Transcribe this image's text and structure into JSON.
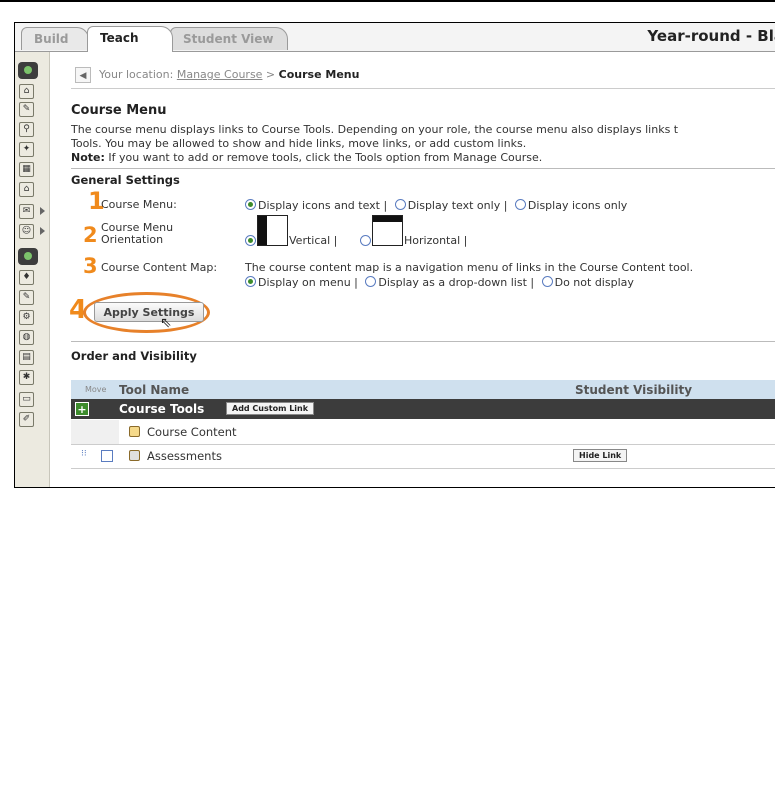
{
  "tabs": {
    "build": "Build",
    "teach": "Teach",
    "student_view": "Student View"
  },
  "course_title": "Year-round - Bla",
  "breadcrumb": {
    "prefix": "Your location:",
    "link": "Manage Course",
    "separator": " > ",
    "current": "Course Menu"
  },
  "page_title": "Course Menu",
  "description": {
    "line1": "The course menu displays links to Course Tools. Depending on your role, the course menu also displays links t",
    "line2": "Tools. You may be allowed to show and hide links, move links, or add custom links.",
    "note_label": "Note:",
    "note_text": " If you want to add or remove tools, click the Tools option from Manage Course."
  },
  "general_settings": {
    "heading": "General Settings",
    "steps": [
      "1",
      "2",
      "3",
      "4"
    ],
    "course_menu_label": "Course Menu:",
    "course_menu_options": [
      "Display icons and text |",
      "Display text only |",
      "Display icons only"
    ],
    "orientation_label_1": "Course Menu",
    "orientation_label_2": "Orientation",
    "orientation_options": [
      "Vertical |",
      "Horizontal |"
    ],
    "content_map_label": "Course Content Map:",
    "content_map_desc": "The course content map is a navigation menu of links in the Course Content tool.",
    "content_map_options": [
      "Display on menu |",
      "Display as a drop-down list |",
      "Do not display"
    ],
    "apply_button": "Apply Settings"
  },
  "order_visibility": {
    "heading": "Order and Visibility",
    "columns": {
      "move": "Move",
      "tool_name": "Tool Name",
      "student_visibility": "Student Visibility"
    },
    "group": {
      "name": "Course Tools",
      "add_button": "Add Custom Link"
    },
    "rows": [
      {
        "name": "Course Content"
      },
      {
        "name": "Assessments",
        "visibility_button": "Hide Link"
      }
    ]
  },
  "colors": {
    "accent": "#f08a1c",
    "header_row": "#3c3c3c",
    "table_header": "#cfe0ee"
  }
}
